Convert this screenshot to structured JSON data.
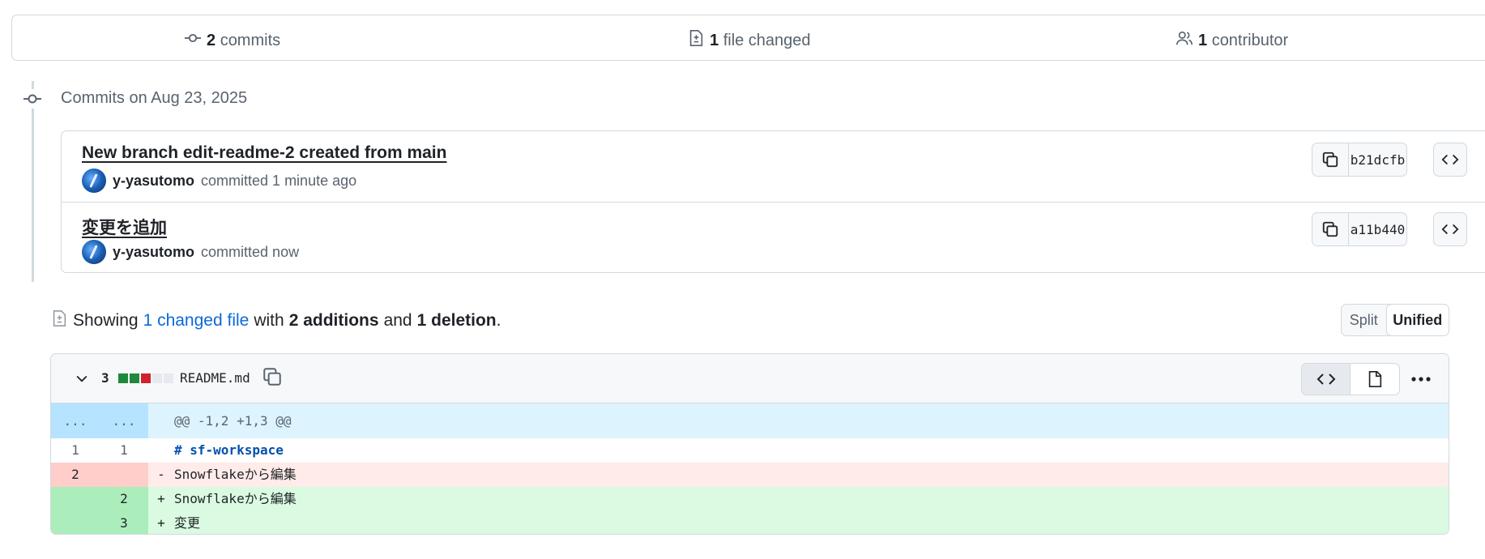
{
  "summary": {
    "commits_count": "2",
    "commits_label": "commits",
    "files_count": "1",
    "files_label": "file changed",
    "contributors_count": "1",
    "contributors_label": "contributor"
  },
  "timeline": {
    "heading": "Commits on Aug 23, 2025"
  },
  "commits": [
    {
      "title": "New branch edit-readme-2 created from main",
      "author": "y-yasutomo",
      "action": "committed 1 minute ago",
      "sha": "b21dcfb"
    },
    {
      "title": "変更を追加",
      "author": "y-yasutomo",
      "action": "committed now",
      "sha": "a11b440"
    }
  ],
  "showing": {
    "prefix": "Showing",
    "link": "1 changed file",
    "with": "with",
    "additions": "2 additions",
    "and": "and",
    "deletions": "1 deletion",
    "period": "."
  },
  "view_toggle": {
    "split": "Split",
    "unified": "Unified",
    "selected": "Unified"
  },
  "diff_file": {
    "change_count": "3",
    "filename": "README.md",
    "diffstat_colors": [
      "#1f883d",
      "#1f883d",
      "#cf222e",
      "#d1d9e0",
      "#d1d9e0"
    ],
    "hunk": {
      "old": "...",
      "new": "...",
      "header": "@@ -1,2 +1,3 @@"
    },
    "lines": [
      {
        "type": "context",
        "old": "1",
        "new": "1",
        "sign": "",
        "text": "# sf-workspace"
      },
      {
        "type": "deletion",
        "old": "2",
        "new": "",
        "sign": "-",
        "text": "Snowflakeから編集"
      },
      {
        "type": "addition",
        "old": "",
        "new": "2",
        "sign": "+",
        "text": "Snowflakeから編集"
      },
      {
        "type": "addition",
        "old": "",
        "new": "3",
        "sign": "+",
        "text": "変更"
      }
    ]
  },
  "icons": {
    "commit": "git-commit-icon",
    "file_diff": "file-diff-icon",
    "people": "people-icon",
    "copy": "copy-icon",
    "code": "code-icon",
    "file": "file-icon",
    "kebab": "kebab-horizontal-icon",
    "chevron": "chevron-down-icon"
  }
}
